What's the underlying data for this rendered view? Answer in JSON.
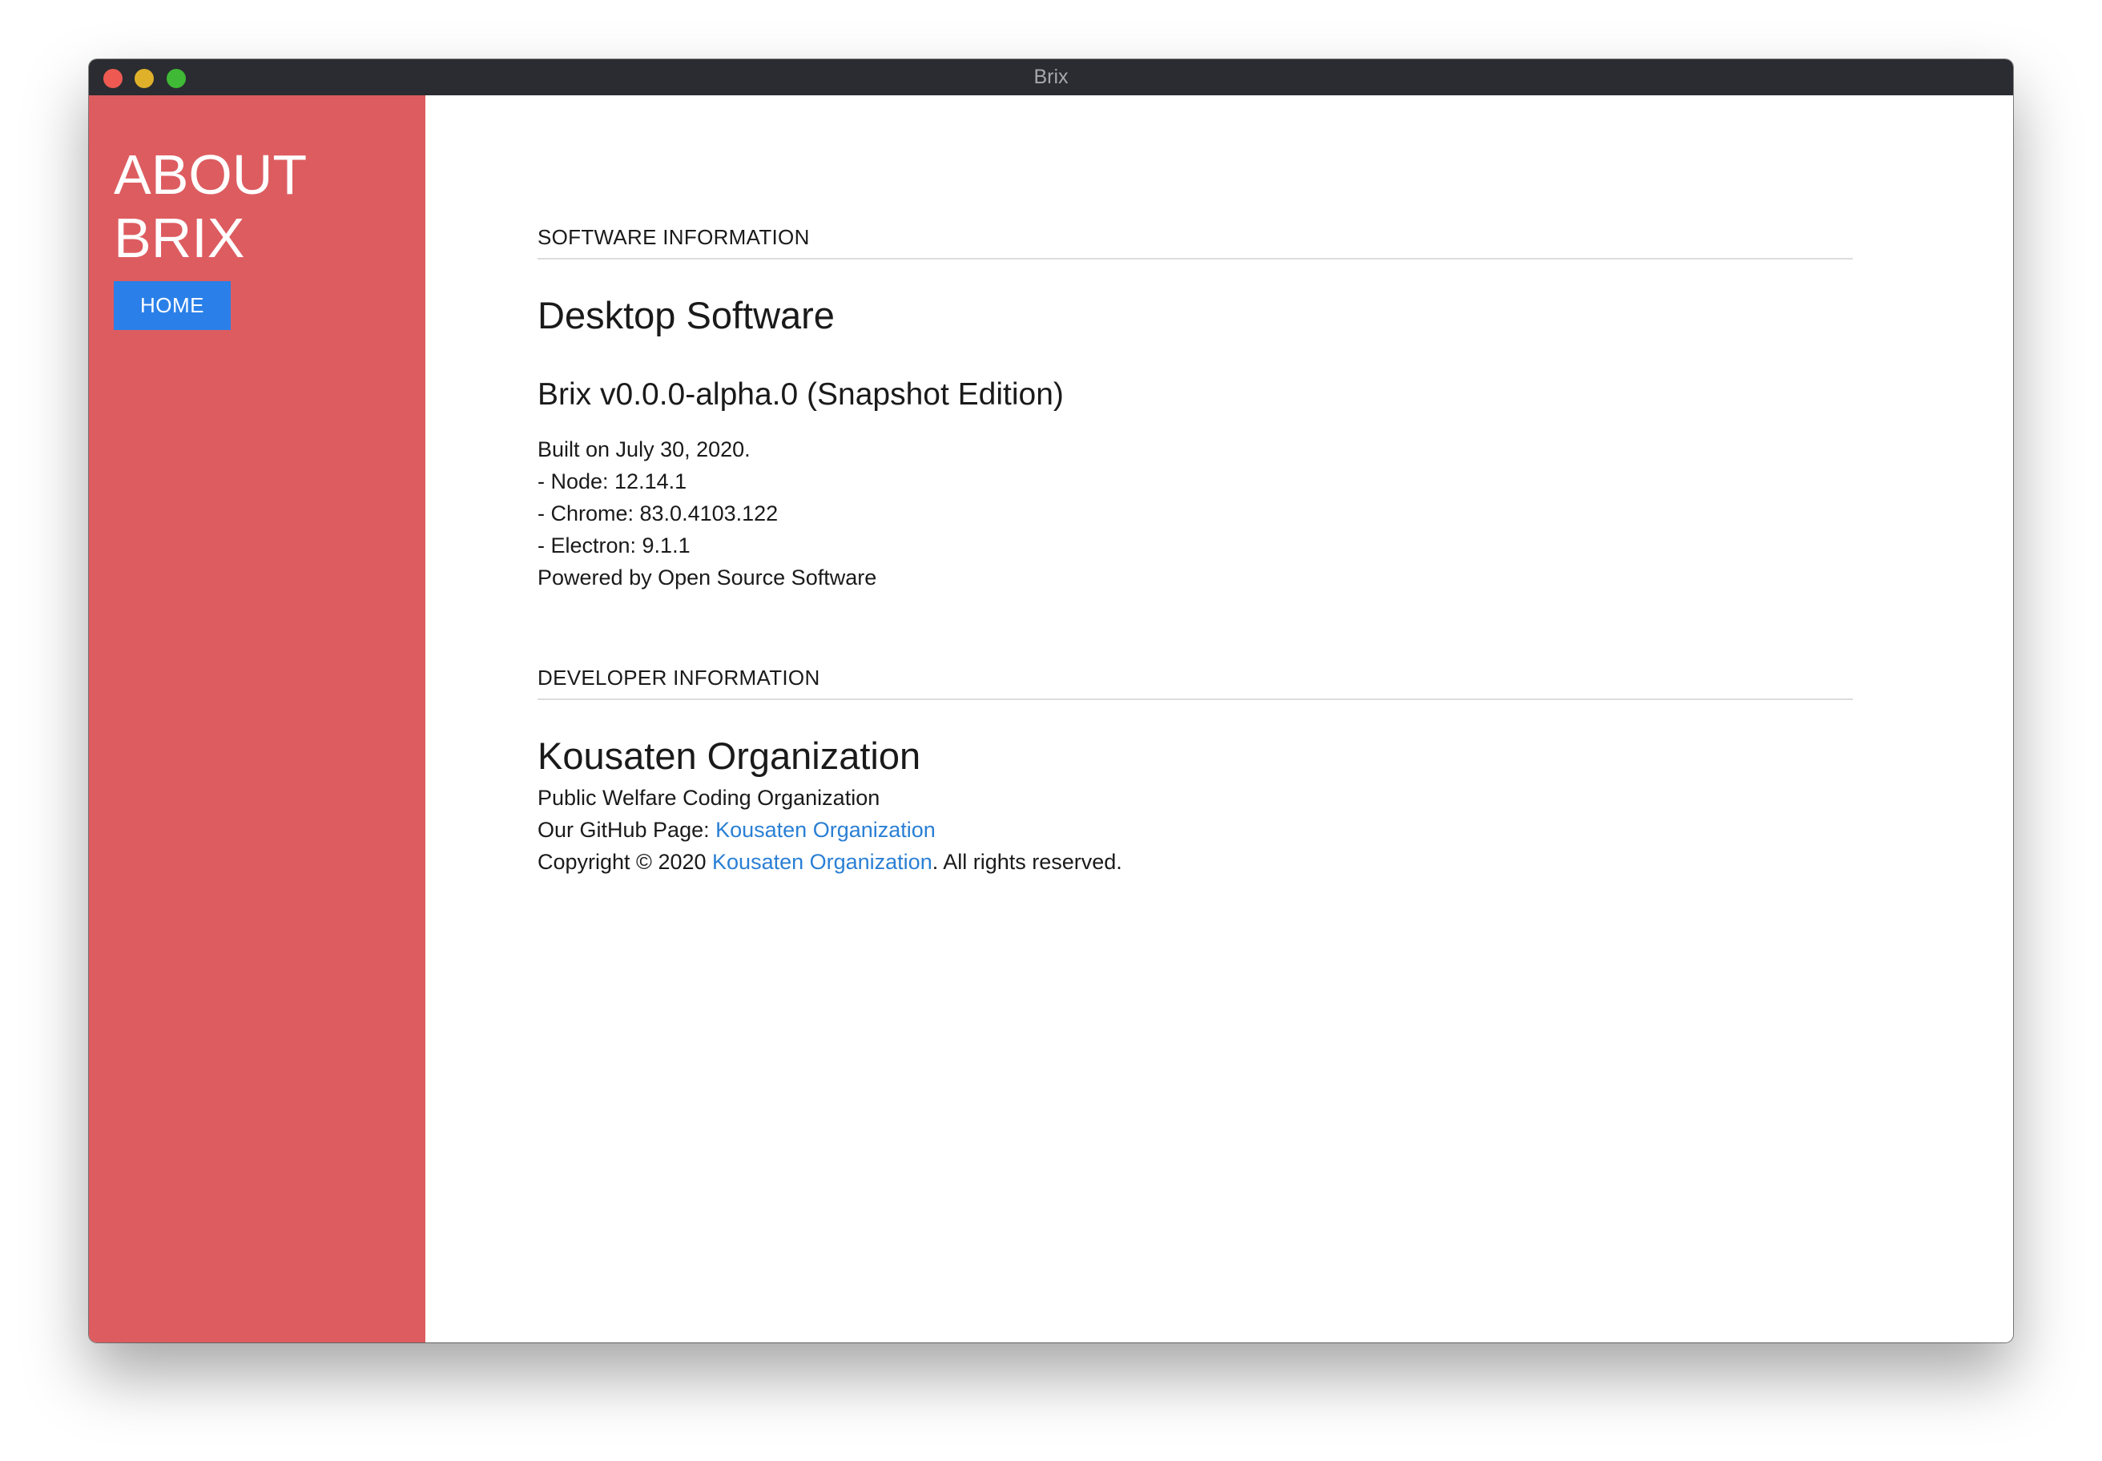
{
  "window": {
    "title": "Brix"
  },
  "sidebar": {
    "title_line1": "ABOUT",
    "title_line2": "BRIX",
    "home_button_label": "HOME"
  },
  "software": {
    "section_heading": "SOFTWARE INFORMATION",
    "title": "Desktop Software",
    "version": "Brix v0.0.0-alpha.0 (Snapshot Edition)",
    "built_on": "Built on July 30, 2020.",
    "node": "- Node: 12.14.1",
    "chrome": "- Chrome: 83.0.4103.122",
    "electron": "- Electron: 9.1.1",
    "powered_by": "Powered by Open Source Software"
  },
  "developer": {
    "section_heading": "DEVELOPER INFORMATION",
    "org_name": "Kousaten Organization",
    "description": "Public Welfare Coding Organization",
    "github_prefix": "Our GitHub Page: ",
    "github_link": "Kousaten Organization",
    "copyright_prefix": "Copyright © 2020 ",
    "copyright_link": "Kousaten Organization",
    "copyright_suffix": ". All rights reserved."
  },
  "colors": {
    "sidebar_bg": "#dd5c60",
    "button_bg": "#2a80e8",
    "link": "#2a7fd4",
    "titlebar_bg": "#2a2c31"
  }
}
